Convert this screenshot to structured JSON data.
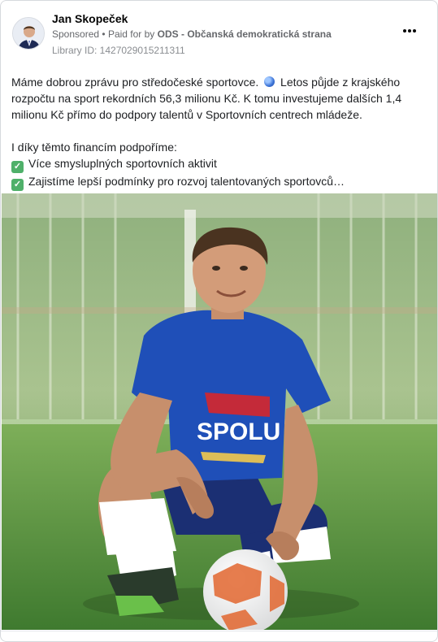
{
  "post": {
    "author": "Jan Skopeček",
    "sponsored_label": "Sponsored",
    "separator": "•",
    "paid_for_prefix": "Paid for by",
    "sponsor": "ODS - Občanská demokratická strana",
    "library_id": "Library ID: 1427029015211311",
    "more_icon": "more-horizontal-icon",
    "text_lines": [
      "Máme dobrou zprávu pro středočeské sportovce.",
      "Letos půjde z krajského",
      "rozpočtu na sport rekordních 56,3 milionu Kč. K tomu investujeme dalších 1,4",
      "milionu Kč přímo do podpory talentů v Sportovních centrech mládeže.",
      "I díky těmto financím podpoříme:",
      "Více smysluplných sportovních aktivit",
      "Zajistíme lepší podmínky pro rozvoj talentovaných sportovců…"
    ],
    "jersey_text": "SPOLU"
  },
  "colors": {
    "accent_green": "#4fb06a",
    "jersey_blue": "#1f4fb8",
    "grass": "#4c8a3a"
  }
}
